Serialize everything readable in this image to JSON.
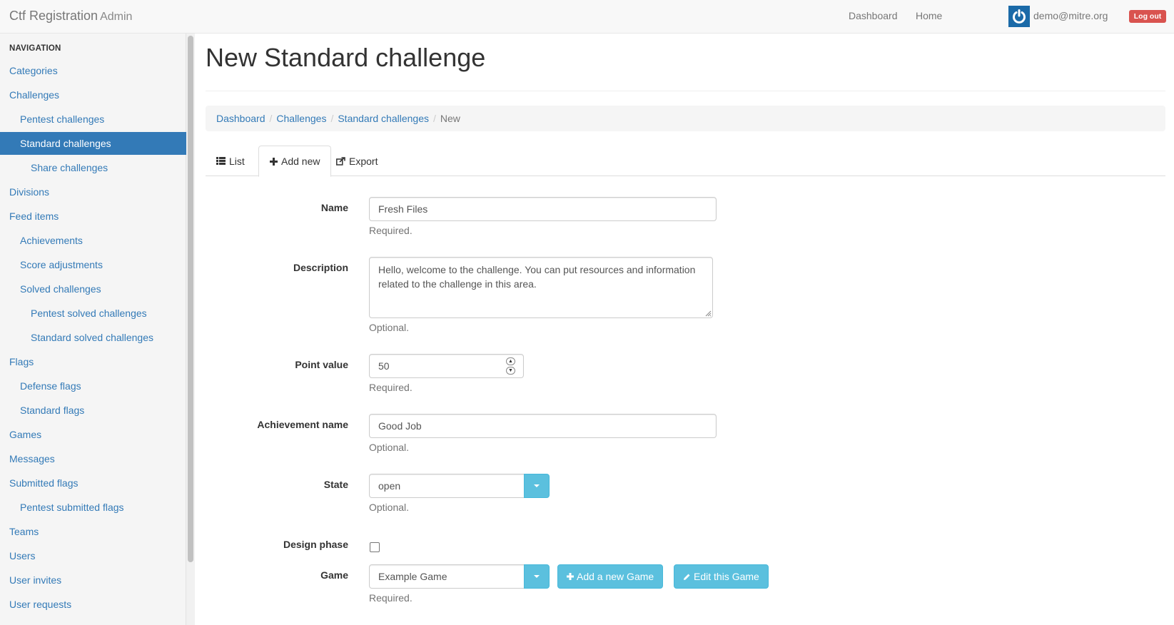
{
  "app": {
    "brand": "Ctf Registration",
    "brand_suffix": "Admin"
  },
  "topnav": {
    "dashboard": "Dashboard",
    "home": "Home",
    "user_email": "demo@mitre.org",
    "logout": "Log out"
  },
  "sidebar": {
    "header": "NAVIGATION",
    "items": [
      {
        "label": "Categories",
        "level": 0,
        "active": false
      },
      {
        "label": "Challenges",
        "level": 0,
        "active": false
      },
      {
        "label": "Pentest challenges",
        "level": 1,
        "active": false
      },
      {
        "label": "Standard challenges",
        "level": 1,
        "active": true
      },
      {
        "label": "Share challenges",
        "level": 2,
        "active": false
      },
      {
        "label": "Divisions",
        "level": 0,
        "active": false
      },
      {
        "label": "Feed items",
        "level": 0,
        "active": false
      },
      {
        "label": "Achievements",
        "level": 1,
        "active": false
      },
      {
        "label": "Score adjustments",
        "level": 1,
        "active": false
      },
      {
        "label": "Solved challenges",
        "level": 1,
        "active": false
      },
      {
        "label": "Pentest solved challenges",
        "level": 2,
        "active": false
      },
      {
        "label": "Standard solved challenges",
        "level": 2,
        "active": false
      },
      {
        "label": "Flags",
        "level": 0,
        "active": false
      },
      {
        "label": "Defense flags",
        "level": 1,
        "active": false
      },
      {
        "label": "Standard flags",
        "level": 1,
        "active": false
      },
      {
        "label": "Games",
        "level": 0,
        "active": false
      },
      {
        "label": "Messages",
        "level": 0,
        "active": false
      },
      {
        "label": "Submitted flags",
        "level": 0,
        "active": false
      },
      {
        "label": "Pentest submitted flags",
        "level": 1,
        "active": false
      },
      {
        "label": "Teams",
        "level": 0,
        "active": false
      },
      {
        "label": "Users",
        "level": 0,
        "active": false
      },
      {
        "label": "User invites",
        "level": 0,
        "active": false
      },
      {
        "label": "User requests",
        "level": 0,
        "active": false
      }
    ]
  },
  "page": {
    "title": "New Standard challenge",
    "breadcrumb": [
      "Dashboard",
      "Challenges",
      "Standard challenges",
      "New"
    ],
    "tabs": {
      "list": "List",
      "add_new": "Add new",
      "export": "Export"
    }
  },
  "form": {
    "name": {
      "label": "Name",
      "value": "Fresh Files",
      "help": "Required."
    },
    "description": {
      "label": "Description",
      "value": "Hello, welcome to the challenge. You can put resources and information related to the challenge in this area.",
      "help": "Optional."
    },
    "point_value": {
      "label": "Point value",
      "value": "50",
      "help": "Required."
    },
    "achievement_name": {
      "label": "Achievement name",
      "value": "Good Job",
      "help": "Optional."
    },
    "state": {
      "label": "State",
      "value": "open",
      "help": "Optional."
    },
    "design_phase": {
      "label": "Design phase",
      "checked": false
    },
    "game": {
      "label": "Game",
      "value": "Example Game",
      "help": "Required.",
      "add_button": "Add a new Game",
      "edit_button": "Edit this Game"
    }
  },
  "colors": {
    "link": "#337ab7",
    "active_nav": "#337ab7",
    "info_button": "#5bc0de",
    "danger": "#d9534f"
  }
}
